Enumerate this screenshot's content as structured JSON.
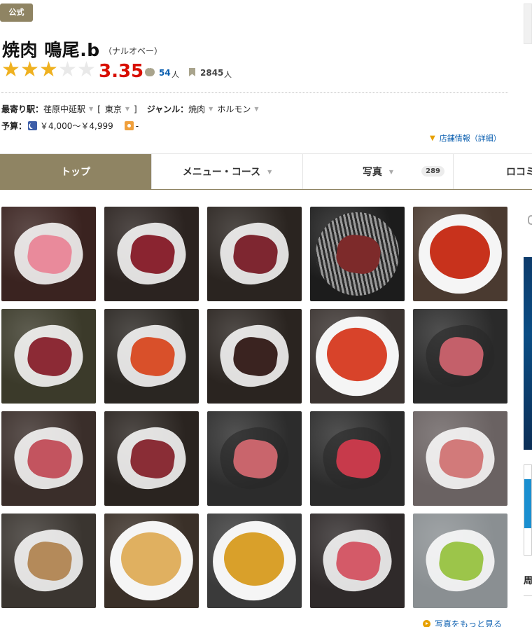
{
  "badge": "公式",
  "restaurant": {
    "name": "焼肉 鳴尾.b",
    "kana": "（ナルオベー）"
  },
  "rating": {
    "score": "3.35",
    "stars_filled": 3,
    "stars_total": 5,
    "star_color": "#efb120",
    "score_color": "#d80e00"
  },
  "reviews": {
    "count": "54",
    "unit": "人",
    "icon": "speech-bubble-icon"
  },
  "bookmarks": {
    "count": "2845",
    "unit": "人",
    "icon": "bookmark-icon"
  },
  "info": {
    "station_label": "最寄り駅：",
    "station": "荏原中延駅",
    "area_open": "[",
    "area": "東京",
    "area_close": "]",
    "genre_label": "ジャンル：",
    "genre1": "焼肉",
    "genre2": "ホルモン",
    "budget_label": "予算：",
    "budget_dinner": "￥4,000～￥4,999",
    "budget_lunch": "-"
  },
  "detail_link": "店舗情報（詳細）",
  "tabs": [
    {
      "label": "トップ",
      "active": true
    },
    {
      "label": "メニュー・コース",
      "dropdown": true
    },
    {
      "label": "写真",
      "dropdown": true,
      "count": "289"
    },
    {
      "label": "ロコミ"
    }
  ],
  "photos": [
    {
      "name": "beef-tongue-plate",
      "bg": "#3a2320",
      "food": "#e98a9b"
    },
    {
      "name": "sliced-beef-with-labels",
      "bg": "#2b2320",
      "food": "#8a2430"
    },
    {
      "name": "rib-and-sagari-plate",
      "bg": "#2a2420",
      "food": "#7e2630"
    },
    {
      "name": "meat-on-grill",
      "bg": "#1c1c1c",
      "food": "#7d2a2a",
      "style": "grill"
    },
    {
      "name": "spicy-soup-bowl",
      "bg": "#4a3a30",
      "food": "#c8321c",
      "style": "soup"
    },
    {
      "name": "grill-table-meat",
      "bg": "#3b3a2a",
      "food": "#8c2a35"
    },
    {
      "name": "kimchi-plate",
      "bg": "#2a2622",
      "food": "#d9502a"
    },
    {
      "name": "dried-meat-bowl",
      "bg": "#2a2420",
      "food": "#3a2320"
    },
    {
      "name": "red-sauce-dish",
      "bg": "#3a3330",
      "food": "#d8432a",
      "style": "soup"
    },
    {
      "name": "marbled-steak-slab",
      "bg": "#2a2a2a",
      "food": "#c4606a",
      "style": "dark"
    },
    {
      "name": "marbled-beef-slices",
      "bg": "#3a2e2a",
      "food": "#c3545f"
    },
    {
      "name": "beef-cuts-with-labels",
      "bg": "#2a2420",
      "food": "#8a2d36"
    },
    {
      "name": "beef-with-lemon",
      "bg": "#2c2c2c",
      "food": "#c9656c",
      "style": "dark"
    },
    {
      "name": "thin-sliced-beef",
      "bg": "#2b2b2b",
      "food": "#c73a4b",
      "style": "dark"
    },
    {
      "name": "assorted-cuts-platter",
      "bg": "#6a6262",
      "food": "#d27a7a"
    },
    {
      "name": "green-onion-tongue",
      "bg": "#3a3530",
      "food": "#b48a5a"
    },
    {
      "name": "cold-noodle-bowl",
      "bg": "#3a3028",
      "food": "#e0b060",
      "style": "soup"
    },
    {
      "name": "curry-soup-bowl",
      "bg": "#3a3a3a",
      "food": "#d9a02a",
      "style": "soup"
    },
    {
      "name": "wagyu-closeup",
      "bg": "#2f2a2a",
      "food": "#d45a68"
    },
    {
      "name": "lime-sour-drink",
      "bg": "#8a8f92",
      "food": "#9cc54a"
    }
  ],
  "side": {
    "heading": "周"
  },
  "more_photos": "写真をもっと見る"
}
